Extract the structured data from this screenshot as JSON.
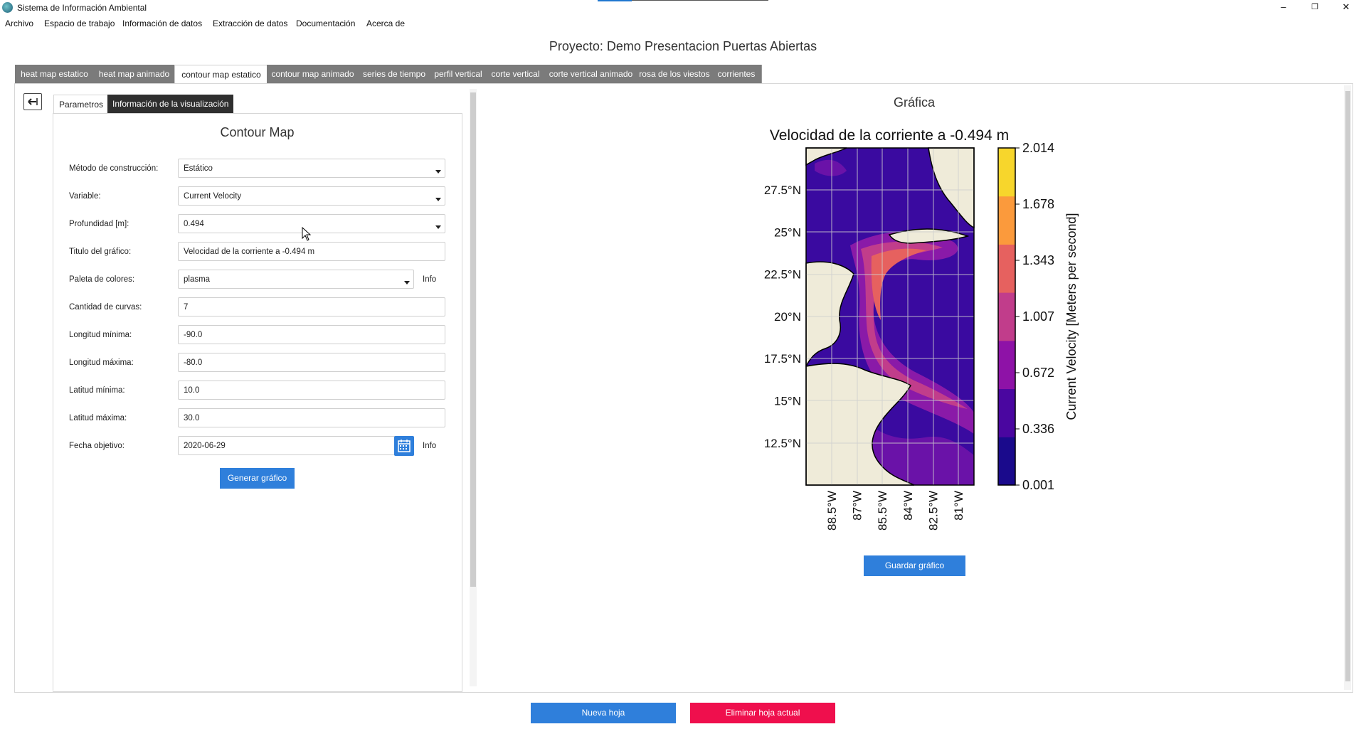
{
  "window": {
    "title": "Sistema de Información Ambiental",
    "minimize": "–",
    "maximize": "❐",
    "close": "✕"
  },
  "menu": [
    "Archivo",
    "Espacio de trabajo",
    "Información de datos",
    "Extracción de datos",
    "Documentación",
    "Acerca de"
  ],
  "project_title": "Proyecto: Demo Presentacion Puertas Abiertas",
  "tabs": [
    "heat map estatico",
    "heat map animado",
    "contour map estatico",
    "contour map animado",
    "series de tiempo",
    "perfil vertical",
    "corte vertical",
    "corte vertical animado",
    "rosa de los viestos",
    "corrientes"
  ],
  "active_tab": "contour map estatico",
  "subtabs": [
    "Parametros",
    "Información de la visualización"
  ],
  "form": {
    "title": "Contour Map",
    "fields": [
      {
        "label": "Método de construcción:",
        "value": "Estático"
      },
      {
        "label": "Variable:",
        "value": "Current Velocity"
      },
      {
        "label": "Profundidad [m]:",
        "value": "0.494"
      },
      {
        "label": "Titulo del gráfico:",
        "value": "Velocidad de la corriente a -0.494 m"
      },
      {
        "label": "Paleta de colores:",
        "value": "plasma"
      },
      {
        "label": "Cantidad de curvas:",
        "value": "7"
      },
      {
        "label": "Longitud mínima:",
        "value": "-90.0"
      },
      {
        "label": "Longitud máxima:",
        "value": "-80.0"
      },
      {
        "label": "Latitud mínima:",
        "value": "10.0"
      },
      {
        "label": "Latitud máxima:",
        "value": "30.0"
      },
      {
        "label": "Fecha objetivo:",
        "value": "2020-06-29"
      }
    ],
    "info_label": "Info",
    "generate_label": "Generar gráfico"
  },
  "viz": {
    "section_title": "Gráfica",
    "save_label": "Guardar gráfico"
  },
  "chart_data": {
    "type": "heatmap",
    "title": "Velocidad de la corriente a -0.494 m",
    "colorbar_label": "Current Velocity [Meters per second]",
    "colorbar_ticks": [
      "2.014",
      "1.678",
      "1.343",
      "1.007",
      "0.672",
      "0.336",
      "0.001"
    ],
    "colorbar_colors": [
      "#f7d62c",
      "#fb9a3c",
      "#e6615f",
      "#c13d8b",
      "#8e12a7",
      "#4a06a0",
      "#1a0a8c"
    ],
    "ylabels": [
      "27.5°N",
      "25°N",
      "22.5°N",
      "20°N",
      "17.5°N",
      "15°N",
      "12.5°N"
    ],
    "xlabels": [
      "88.5°W",
      "87°W",
      "85.5°W",
      "84°W",
      "82.5°W",
      "81°W"
    ],
    "land_color": "#efebd9",
    "ocean_color": "#3a0aa0"
  },
  "bottom": {
    "new_sheet": "Nueva hoja",
    "delete_sheet": "Eliminar hoja actual"
  }
}
